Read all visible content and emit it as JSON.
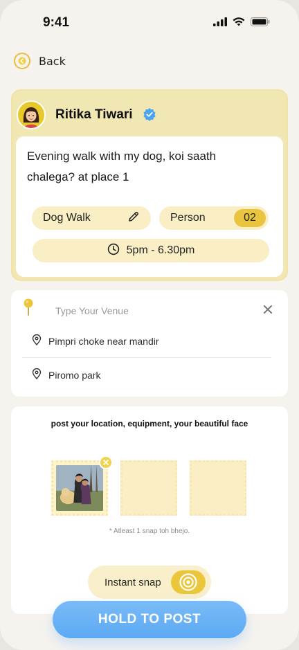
{
  "status_bar": {
    "time": "9:41",
    "icons": [
      "signal-icon",
      "wifi-icon",
      "battery-icon"
    ]
  },
  "nav": {
    "back_label": "Back",
    "back_icon": "chevron-left-icon"
  },
  "post": {
    "author_name": "Ritika Tiwari",
    "verified_icon": "verified-badge-icon",
    "description": "Evening walk with my dog, koi saath chalega? at place 1",
    "activity": "Dog Walk",
    "person_label": "Person",
    "person_count": "02",
    "time_range": "5pm - 6.30pm"
  },
  "venue": {
    "placeholder": "Type Your Venue",
    "suggestions": [
      "Pimpri choke near mandir",
      "Piromo park"
    ]
  },
  "photos": {
    "title": "post your location, equipment, your beautiful face",
    "hint": "* Atleast 1 snap toh bhejo.",
    "slots": [
      "filled",
      "empty",
      "empty"
    ]
  },
  "snap": {
    "label": "Instant snap"
  },
  "cta": {
    "label": "HOLD TO POST"
  },
  "colors": {
    "accent_yellow": "#e9c43e",
    "card_yellow": "#f1e7b3",
    "pill_yellow": "#faeec4",
    "cta_blue": "#6ab2f5",
    "verified_blue": "#4aa3f0"
  }
}
